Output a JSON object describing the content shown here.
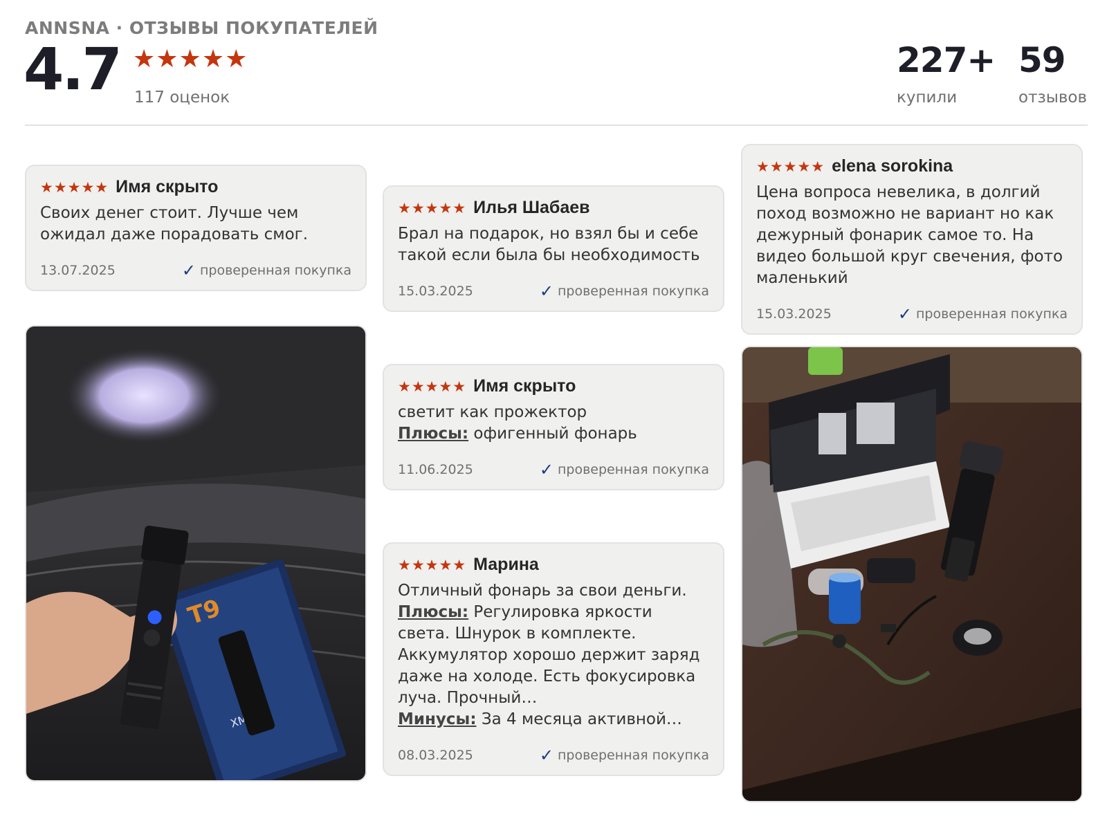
{
  "header": {
    "title": "ANNSNA · ОТЗЫВЫ ПОКУПАТЕЛЕЙ",
    "rating": "4.7",
    "stars": "★★★★★",
    "rating_count": "117 оценок",
    "bought_num": "227+",
    "bought_label": "купили",
    "reviews_num": "59",
    "reviews_label": "отзывов"
  },
  "colors": {
    "star": "#c4360e",
    "check": "#1a3a80",
    "card_bg": "#f0f0ef"
  },
  "reviews": [
    {
      "stars": "★★★★★",
      "name": "Имя скрыто",
      "text": "Своих денег стоит. Лучше чем ожидал даже порадовать смог.",
      "date": "13.07.2025",
      "verified": "проверенная покупка"
    },
    {
      "stars": "★★★★★",
      "name": "Илья Шабаев",
      "text": "Брал на подарок, но взял бы и себе такой если была бы необходимость",
      "date": "15.03.2025",
      "verified": "проверенная покупка"
    },
    {
      "stars": "★★★★★",
      "name": "Имя скрыто",
      "text": "светит как прожектор",
      "pros_label": "Плюсы:",
      "pros": "офигенный фонарь",
      "date": "11.06.2025",
      "verified": "проверенная покупка"
    },
    {
      "stars": "★★★★★",
      "name": "Марина",
      "text": "Отличный фонарь за свои деньги.",
      "pros_label": "Плюсы:",
      "pros": "Регулировка яркости света. Шнурок в комплекте. Аккумулятор хорошо держит заряд даже на холоде. Есть фокусировка луча. Прочный…",
      "cons_label": "Минусы:",
      "cons": "За 4 месяца активной…",
      "date": "08.03.2025",
      "verified": "проверенная покупка"
    },
    {
      "stars": "★★★★★",
      "name": "elena sorokina",
      "text": "Цена вопроса невелика, в долгий поход возможно не вариант но как дежурный фонарик самое то. На видео большой круг свечения, фото маленький",
      "date": "15.03.2025",
      "verified": "проверенная покупка"
    }
  ],
  "photo1": {
    "box_label": "T9",
    "box_sub": "XML T9"
  }
}
